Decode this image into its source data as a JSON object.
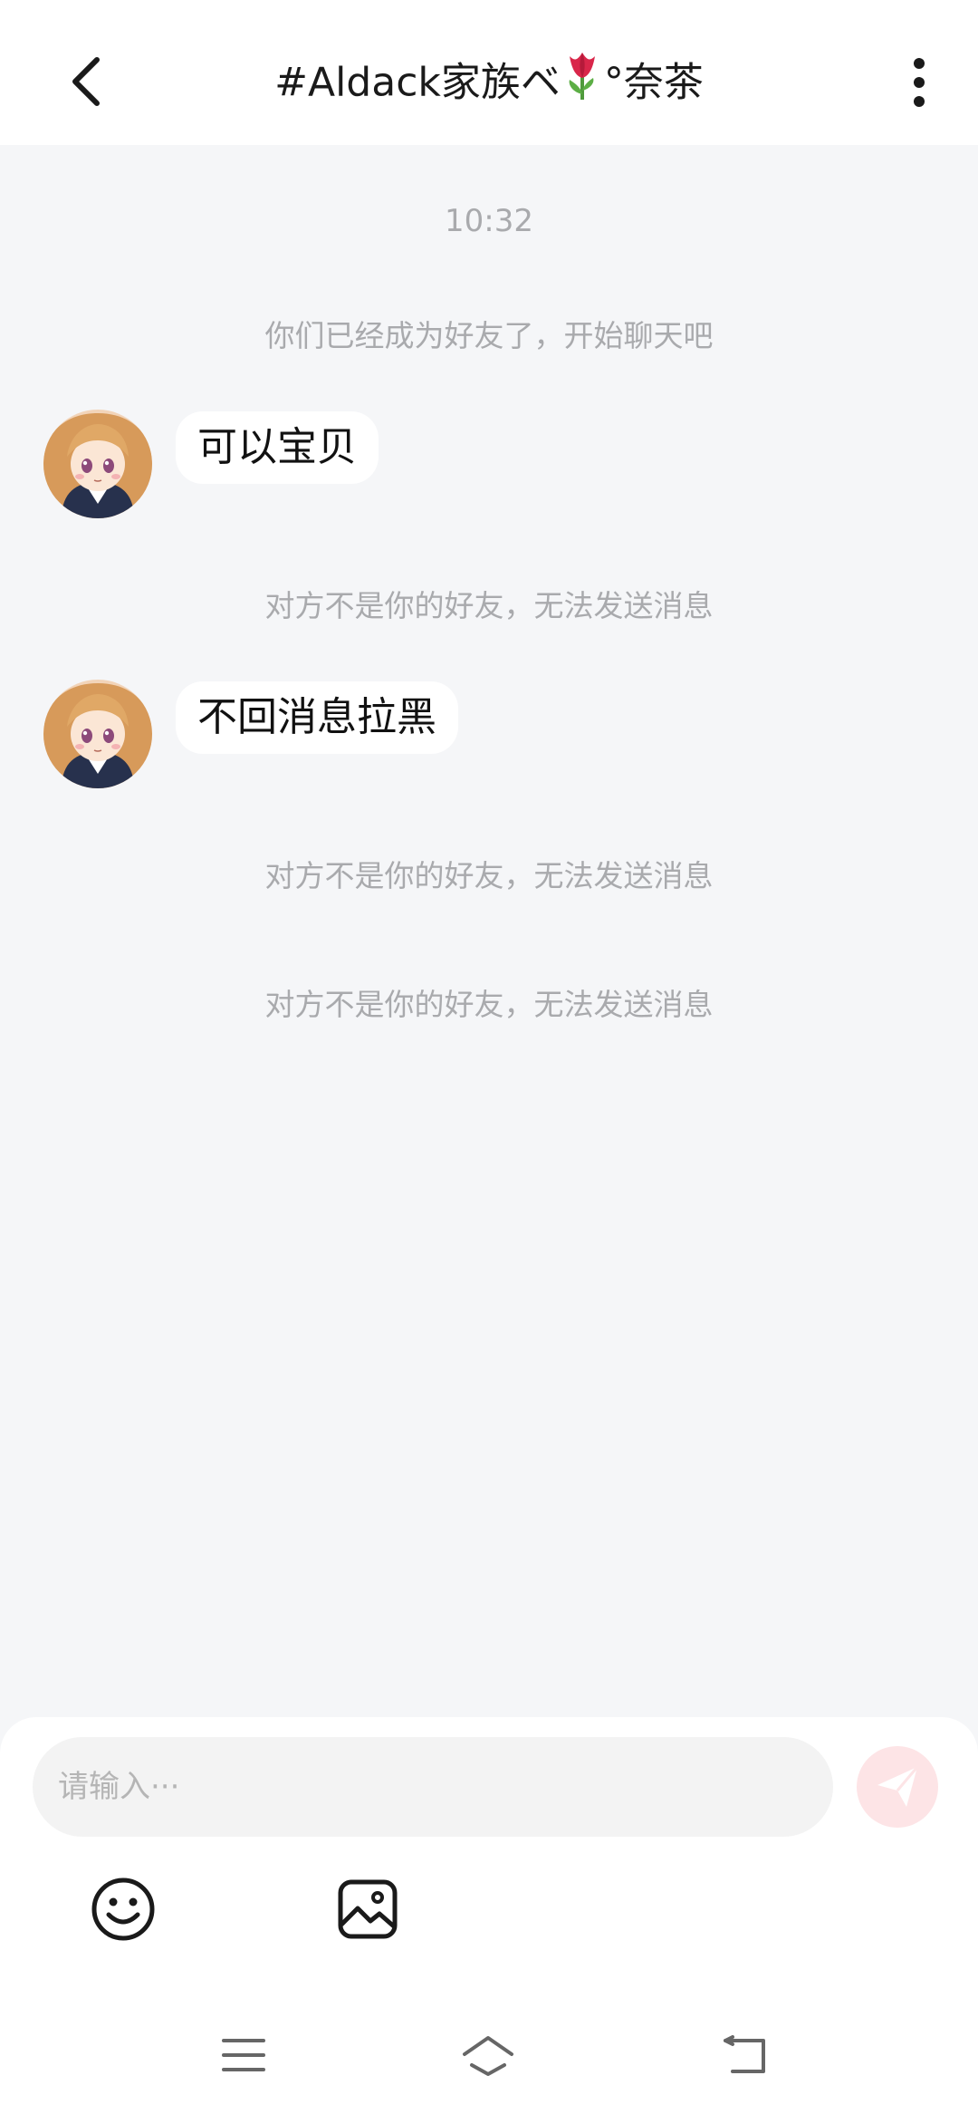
{
  "header": {
    "title_prefix": "#Aldack家族ベ",
    "title_suffix": "°奈茶",
    "back_icon": "chevron-left-icon",
    "more_icon": "vertical-dots-icon"
  },
  "chat": {
    "timestamp": "10:32",
    "messages": [
      {
        "type": "system",
        "text": "你们已经成为好友了，开始聊天吧"
      },
      {
        "type": "received",
        "text": "可以宝贝",
        "avatar": "anime-girl-avatar"
      },
      {
        "type": "system",
        "text": "对方不是你的好友，无法发送消息"
      },
      {
        "type": "received",
        "text": "不回消息拉黑",
        "avatar": "anime-girl-avatar"
      },
      {
        "type": "system",
        "text": "对方不是你的好友，无法发送消息"
      },
      {
        "type": "system",
        "text": "对方不是你的好友，无法发送消息"
      }
    ]
  },
  "input": {
    "placeholder": "请输入···",
    "value": "",
    "send_icon": "paper-plane-icon",
    "emoji_icon": "smiley-icon",
    "image_icon": "image-icon"
  },
  "navbar": {
    "icons": [
      "menu-icon",
      "home-icon",
      "back-icon"
    ]
  },
  "colors": {
    "background": "#f5f6f8",
    "bubble": "#ffffff",
    "system_text": "#a9aaad",
    "send_button": "#fde4e6",
    "send_icon": "#ffffff"
  }
}
